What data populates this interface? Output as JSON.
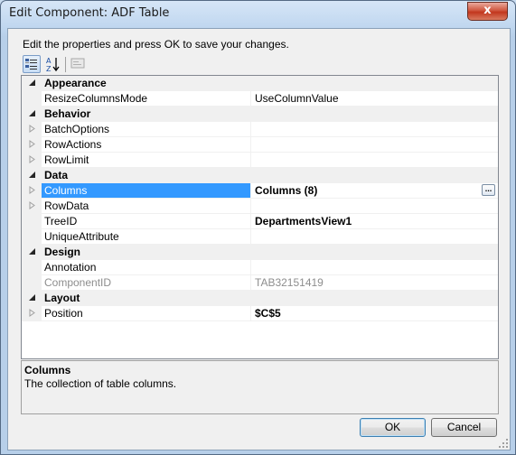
{
  "window": {
    "title": "Edit Component: ADF Table",
    "close_label": "x"
  },
  "instruction": "Edit the properties and press OK to save your changes.",
  "toolbar": {
    "buttons": [
      "categorized-view",
      "alphabetical-sort",
      "property-pages"
    ]
  },
  "grid": {
    "rows": [
      {
        "type": "category",
        "label": "Appearance"
      },
      {
        "type": "property",
        "name": "ResizeColumnsMode",
        "value": "UseColumnValue"
      },
      {
        "type": "category",
        "label": "Behavior"
      },
      {
        "type": "property",
        "name": "BatchOptions",
        "value": "",
        "expandable": true
      },
      {
        "type": "property",
        "name": "RowActions",
        "value": "",
        "expandable": true
      },
      {
        "type": "property",
        "name": "RowLimit",
        "value": "",
        "expandable": true
      },
      {
        "type": "category",
        "label": "Data"
      },
      {
        "type": "property",
        "name": "Columns",
        "value": "Columns (8)",
        "expandable": true,
        "selected": true,
        "bold": true
      },
      {
        "type": "property",
        "name": "RowData",
        "value": "",
        "expandable": true
      },
      {
        "type": "property",
        "name": "TreeID",
        "value": "DepartmentsView1",
        "bold": true
      },
      {
        "type": "property",
        "name": "UniqueAttribute",
        "value": ""
      },
      {
        "type": "category",
        "label": "Design"
      },
      {
        "type": "property",
        "name": "Annotation",
        "value": ""
      },
      {
        "type": "property",
        "name": "ComponentID",
        "value": "TAB32151419",
        "readonly": true
      },
      {
        "type": "category",
        "label": "Layout"
      },
      {
        "type": "property",
        "name": "Position",
        "value": "$C$5",
        "expandable": true,
        "bold": true
      }
    ],
    "ellipsis_label": "..."
  },
  "description": {
    "title": "Columns",
    "text": "The collection of table columns."
  },
  "buttons": {
    "ok": "OK",
    "cancel": "Cancel"
  },
  "colors": {
    "selection": "#3399ff",
    "category_bg": "#f0f0f0",
    "readonly_text": "#8d8d8d"
  }
}
